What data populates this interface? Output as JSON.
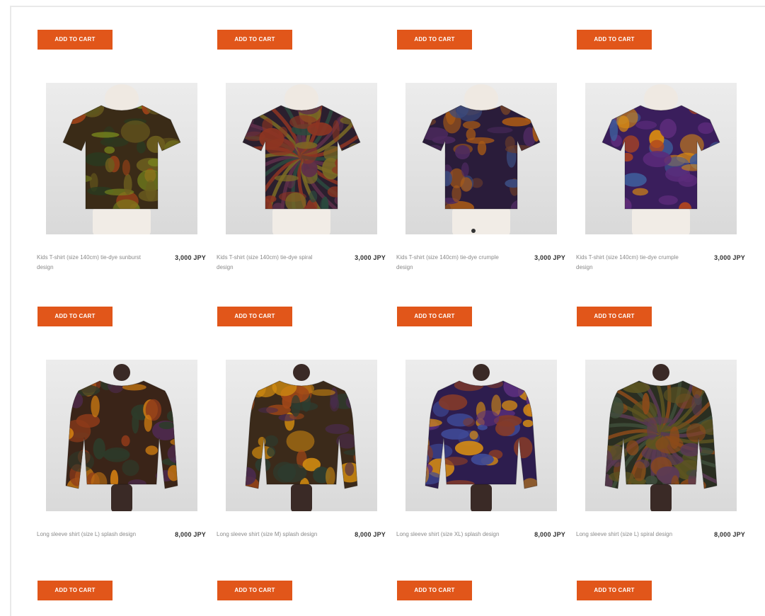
{
  "colors": {
    "accent": "#e1561a",
    "price": "#2f2f2f",
    "name": "#8a8a8a"
  },
  "add_to_cart_label": "ADD TO CART",
  "products": [
    {
      "name": "Kids T-shirt (size 140cm) tie-dye sunburst design",
      "price": "3,000 JPY",
      "image": "tie-dye-kids-tshirt-olive-icon",
      "palette": [
        "#3a2b17",
        "#6b5d1e",
        "#a34418",
        "#7a8a1d",
        "#2a3a20"
      ]
    },
    {
      "name": "Kids T-shirt (size 140cm) tie-dye spiral design",
      "price": "3,000 JPY",
      "image": "tie-dye-kids-tshirt-spiral-icon",
      "palette": [
        "#2b1f2e",
        "#5e2f4a",
        "#7d6c24",
        "#8e3522",
        "#2b4a3e"
      ]
    },
    {
      "name": "Kids T-shirt (size 140cm) tie-dye crumple design",
      "price": "3,000 JPY",
      "image": "tie-dye-kids-tshirt-purple-icon",
      "palette": [
        "#2a1c3a",
        "#4d2a5f",
        "#a85a16",
        "#6b3d2a",
        "#3b4b7d"
      ]
    },
    {
      "name": "Kids T-shirt (size 140cm) tie-dye crumple design",
      "price": "3,000 JPY",
      "image": "tie-dye-kids-tshirt-violet-orange-icon",
      "palette": [
        "#3a1e5c",
        "#5b2b7a",
        "#d98a12",
        "#b2461e",
        "#3f5c9a"
      ]
    },
    {
      "name": "Long sleeve shirt (size L) splash design",
      "price": "8,000 JPY",
      "image": "tie-dye-long-sleeve-orange-icon",
      "palette": [
        "#3a2418",
        "#8d3a1a",
        "#cc7a12",
        "#4e2a4f",
        "#2d3b2a"
      ]
    },
    {
      "name": "Long sleeve shirt (size M) splash design",
      "price": "8,000 JPY",
      "image": "tie-dye-long-sleeve-rust-icon",
      "palette": [
        "#3b2a1a",
        "#a14718",
        "#d08a10",
        "#4a2b4e",
        "#2c3d31"
      ]
    },
    {
      "name": "Long sleeve shirt (size XL) splash design",
      "price": "8,000 JPY",
      "image": "tie-dye-long-sleeve-purple-icon",
      "palette": [
        "#2d1d4e",
        "#5a2f7d",
        "#d38a16",
        "#823a2a",
        "#3f4a96"
      ]
    },
    {
      "name": "Long sleeve shirt (size L) spiral design",
      "price": "8,000 JPY",
      "image": "tie-dye-long-sleeve-spiral-icon",
      "palette": [
        "#2a2e21",
        "#5c5421",
        "#8c4a1a",
        "#3e4d3a",
        "#5b3a54"
      ]
    }
  ]
}
